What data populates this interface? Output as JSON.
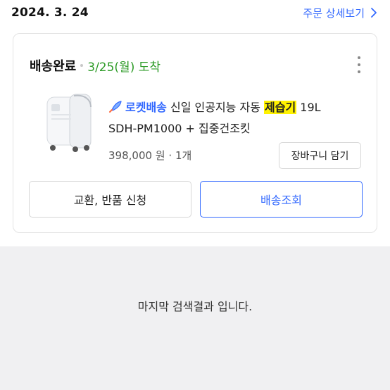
{
  "order": {
    "date": "2024. 3. 24",
    "detail_link": "주문 상세보기"
  },
  "card": {
    "status": "배송완료",
    "arrival": "3/25(월) 도착",
    "product": {
      "rocket_label": "로켓배송",
      "name_before": "신일 인공지능 자동",
      "name_highlight": "제습기",
      "name_after": "19L",
      "name_line2": "SDH-PM1000 + 집중건조킷",
      "price": "398,000 원",
      "quantity": "1개"
    },
    "cart_button": "장바구니 담기",
    "exchange_button": "교환, 반품 신청",
    "track_button": "배송조회"
  },
  "footer": {
    "end_message": "마지막 검색결과 입니다."
  },
  "colors": {
    "accent": "#346aff",
    "arrival_green": "#2d9b27",
    "highlight": "#fff200"
  },
  "icons": {
    "chevron": "chevron-right-icon",
    "more": "more-vertical-icon",
    "rocket": "rocket-icon"
  }
}
